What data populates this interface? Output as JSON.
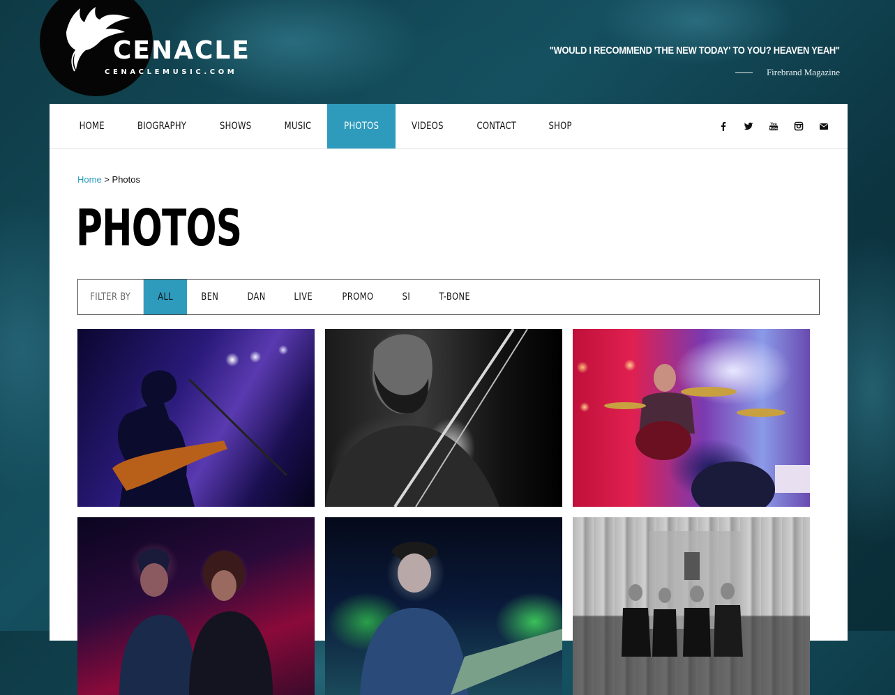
{
  "brand": {
    "name": "CENACLE",
    "url": "CENACLEMUSIC.COM"
  },
  "quote": {
    "text": "\"WOULD I RECOMMEND 'THE NEW TODAY' TO YOU? HEAVEN YEAH\"",
    "source": "Firebrand Magazine"
  },
  "nav": {
    "items": [
      {
        "label": "HOME"
      },
      {
        "label": "BIOGRAPHY"
      },
      {
        "label": "SHOWS"
      },
      {
        "label": "MUSIC"
      },
      {
        "label": "PHOTOS",
        "active": true
      },
      {
        "label": "VIDEOS"
      },
      {
        "label": "CONTACT"
      },
      {
        "label": "SHOP"
      }
    ],
    "socials": [
      "facebook-icon",
      "twitter-icon",
      "youtube-icon",
      "instagram-icon",
      "envelope-icon"
    ]
  },
  "breadcrumb": {
    "home": "Home",
    "separator": ">",
    "current": "Photos"
  },
  "page": {
    "title": "PHOTOS"
  },
  "filter": {
    "label": "FILTER BY",
    "options": [
      {
        "label": "ALL",
        "active": true
      },
      {
        "label": "BEN"
      },
      {
        "label": "DAN"
      },
      {
        "label": "LIVE"
      },
      {
        "label": "PROMO"
      },
      {
        "label": "SI"
      },
      {
        "label": "T-BONE"
      }
    ]
  },
  "colors": {
    "accent": "#2e9bbd",
    "text": "#111111",
    "card": "#ffffff"
  }
}
